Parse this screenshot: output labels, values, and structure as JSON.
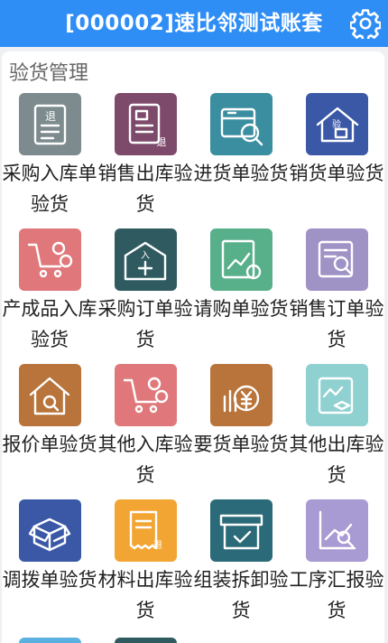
{
  "header": {
    "title": "[000002]速比邻测试账套"
  },
  "section": {
    "title": "验货管理"
  },
  "tiles": [
    {
      "label": "采购入库单验货",
      "color": "#7d8a8e",
      "icon": "return-doc-icon"
    },
    {
      "label": "销售出库验货",
      "color": "#7e4a6b",
      "icon": "sales-return-icon"
    },
    {
      "label": "进货单验货",
      "color": "#3a8ea0",
      "icon": "inspect-box-icon"
    },
    {
      "label": "销货单验货",
      "color": "#3a58a6",
      "icon": "truck-home-icon"
    },
    {
      "label": "产成品入库验货",
      "color": "#e0787b",
      "icon": "cart-gear-icon"
    },
    {
      "label": "采购订单验货",
      "color": "#2f5a60",
      "icon": "warehouse-in-icon"
    },
    {
      "label": "请购单验货",
      "color": "#58b08a",
      "icon": "chart-gear-icon"
    },
    {
      "label": "销售订单验货",
      "color": "#9f93c6",
      "icon": "search-doc-icon"
    },
    {
      "label": "报价单验货",
      "color": "#b8743a",
      "icon": "home-search-icon"
    },
    {
      "label": "其他入库验货",
      "color": "#e0787b",
      "icon": "cart-gear-icon"
    },
    {
      "label": "要货单验货",
      "color": "#b8743a",
      "icon": "yen-growth-icon"
    },
    {
      "label": "其他出库验货",
      "color": "#8fd0d0",
      "icon": "clipboard-box-icon"
    },
    {
      "label": "调拨单验货",
      "color": "#3a58a6",
      "icon": "open-box-icon"
    },
    {
      "label": "材料出库验货",
      "color": "#f2a533",
      "icon": "receipt-icon"
    },
    {
      "label": "组装拆卸验货",
      "color": "#2b6a78",
      "icon": "box-check-icon"
    },
    {
      "label": "工序汇报验货",
      "color": "#a89ad2",
      "icon": "chart-search-icon"
    }
  ],
  "partial_tiles": [
    {
      "color": "#5bb0e0"
    },
    {
      "color": "#2f5a60"
    }
  ]
}
